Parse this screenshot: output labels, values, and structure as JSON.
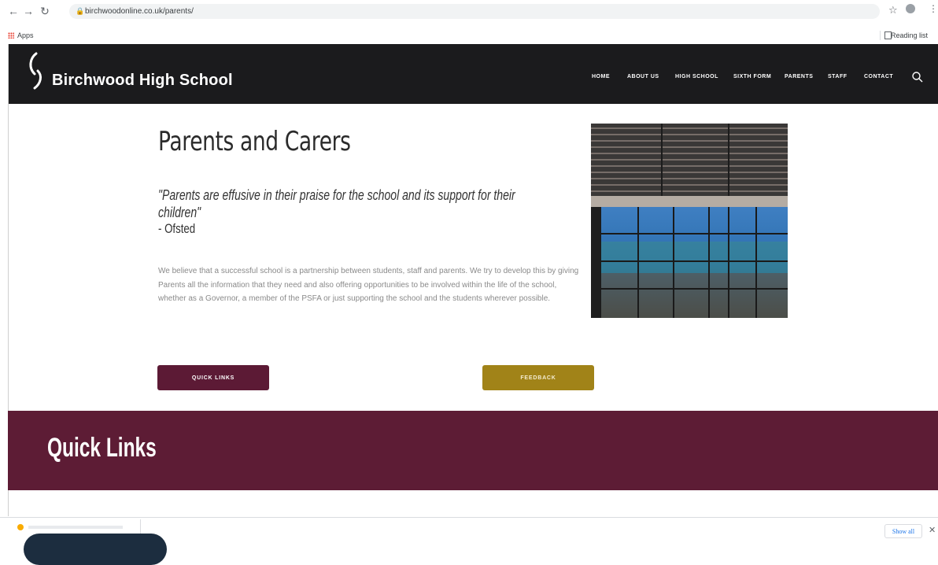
{
  "browser": {
    "url": "birchwoodonline.co.uk/parents/",
    "bookmarks_apps": "Apps",
    "reading_list": "Reading list"
  },
  "site": {
    "title": "Birchwood High School",
    "nav": [
      "HOME",
      "ABOUT US",
      "HIGH SCHOOL",
      "SIXTH FORM",
      "PARENTS",
      "STAFF",
      "CONTACT"
    ]
  },
  "main": {
    "heading": "Parents and Carers",
    "quote": "\"Parents are effusive in their praise for the school and its support for their children\"",
    "quote_source": "- Ofsted",
    "body": "We believe that a successful school is a partnership between students, staff and parents.  We try to develop this by giving Parents all the information that they need and also offering opportunities to be involved within the life of the school, whether as a Governor, a member of the PSFA or just supporting the school and the students wherever possible.",
    "quick_links_button": "QUICK LINKS",
    "feedback_button": "FEEDBACK"
  },
  "band": {
    "title": "Quick Links"
  },
  "downloads": {
    "show_all": "Show all"
  },
  "colors": {
    "header_bg": "#1b1b1d",
    "maroon": "#5c1a35",
    "gold": "#a18318"
  }
}
